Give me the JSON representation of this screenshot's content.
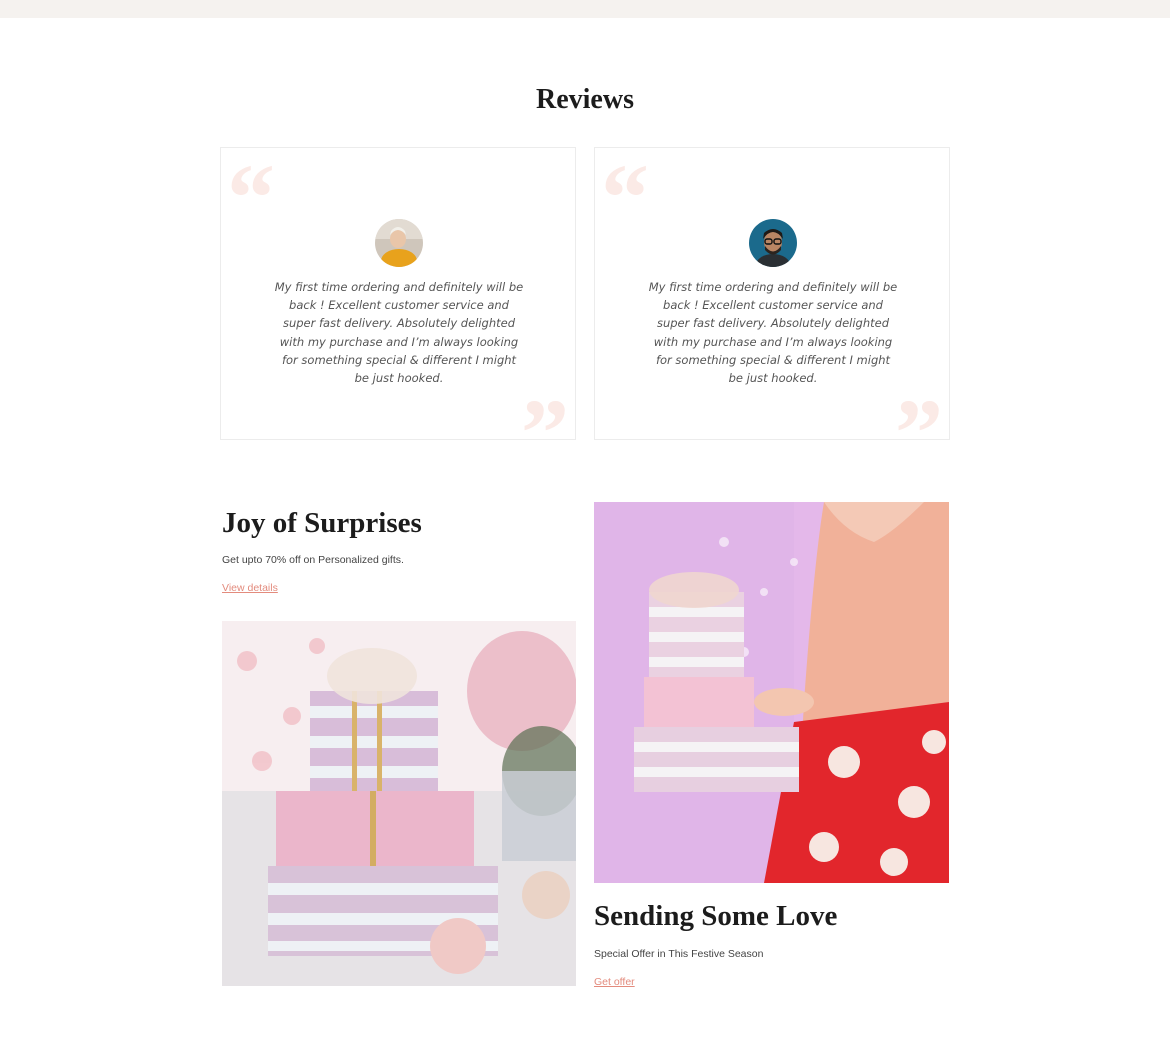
{
  "reviews": {
    "heading": "Reviews",
    "items": [
      {
        "avatar_icon": "avatar-woman-icon",
        "text": "My first time ordering and definitely will be back ! Excellent customer service and super fast delivery. Absolutely delighted with my purchase and I’m always looking for something special & different I might be just hooked."
      },
      {
        "avatar_icon": "avatar-man-icon",
        "text": "My first time ordering and definitely will be back ! Excellent customer service and super fast delivery. Absolutely delighted with my purchase and I’m always looking for something special & different I might be just hooked."
      }
    ],
    "quote_open": "“",
    "quote_close": "”"
  },
  "promos": [
    {
      "title": "Joy of Surprises",
      "subtitle": "Get upto 70% off on Personalized gifts.",
      "link": "View details"
    },
    {
      "title": "Sending Some Love",
      "subtitle": "Special Offer in This Festive Season",
      "link": "Get offer"
    }
  ],
  "colors": {
    "accent_link": "#e38b7d",
    "quote_mark": "#fbeae6",
    "top_strip": "#f5f2ef"
  }
}
